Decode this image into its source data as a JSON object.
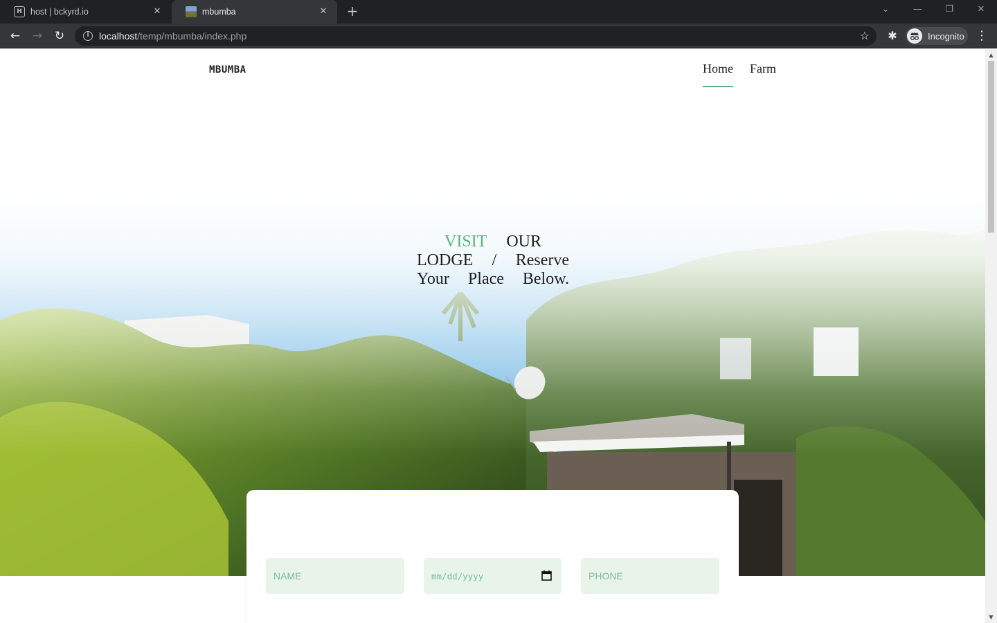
{
  "browser": {
    "tabs": [
      {
        "title": "host | bckyrd.io",
        "active": false,
        "favicon": "h-box-icon"
      },
      {
        "title": "mbumba",
        "active": true,
        "favicon": "landscape-photo-icon"
      }
    ],
    "new_tab_icon": "+",
    "window_controls": {
      "tab_search": "⌄",
      "minimize": "—",
      "restore": "❐",
      "close": "✕"
    },
    "address": {
      "host": "localhost",
      "path": "/temp/mbumba/index.php"
    },
    "nav_icons": {
      "back": "←",
      "forward": "→",
      "reload": "↻",
      "info": "i",
      "bookmark": "☆",
      "extensions": "✱",
      "menu": "⋮"
    },
    "profile_label": "Incognito"
  },
  "site": {
    "brand": "MBUMBA",
    "nav": [
      {
        "label": "Home",
        "active": true
      },
      {
        "label": "Farm",
        "active": false
      }
    ],
    "hero": {
      "accent_word": "VISIT",
      "line1_rest": "OUR",
      "line2": "LODGE / Reserve",
      "line3": "Your Place Below."
    },
    "booking": {
      "name_placeholder": "NAME",
      "date_placeholder": "mm/dd/yyyy",
      "phone_placeholder": "PHONE"
    }
  },
  "colors": {
    "accent_green": "#5fb17c",
    "field_bg": "#e8f3ea",
    "placeholder_green": "#7fbf95",
    "chrome_dark": "#202124",
    "chrome_mid": "#35363a"
  }
}
